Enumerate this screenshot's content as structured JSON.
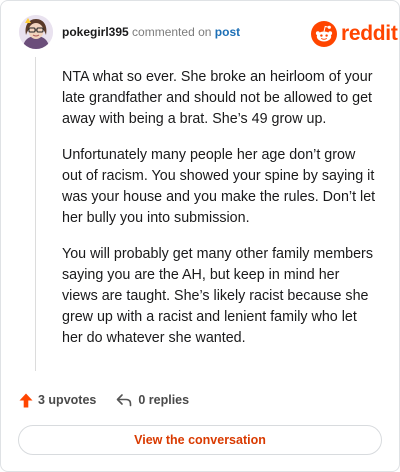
{
  "comment": {
    "username": "pokegirl395",
    "action_text": "commented on",
    "post_link": "post",
    "paragraphs": [
      "NTA what so ever. She broke an heirloom of your late grandfather and should not be allowed to get away with being a brat. She’s 49 grow up.",
      "Unfortunately many people her age don’t grow out of racism. You showed your spine by saying it was your house and you make the rules. Don’t let her bully you into submission.",
      "You will probably get many other family members saying you are the AH, but keep in mind her views are taught. She’s likely racist because she grew up with a racist and lenient family who let her do whatever she wanted."
    ]
  },
  "brand": {
    "name": "reddit",
    "color": "#ff4500"
  },
  "actions": {
    "upvotes": "3 upvotes",
    "replies": "0 replies"
  },
  "footer": {
    "view_button": "View the conversation"
  },
  "icons": {
    "avatar": "user-avatar",
    "logo": "reddit-snoo-icon",
    "upvote": "upvote-arrow-icon",
    "reply": "reply-arrow-icon"
  }
}
